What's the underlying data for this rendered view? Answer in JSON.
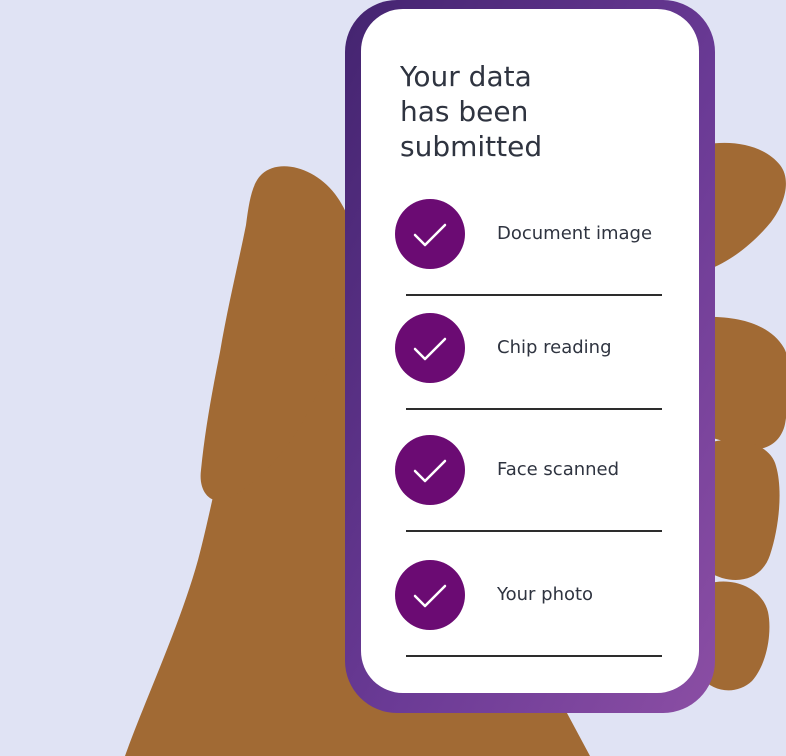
{
  "confirmation": {
    "title": "Your data\nhas been\nsubmitted",
    "items": [
      {
        "label": "Document image",
        "status_icon": "check-icon"
      },
      {
        "label": "Chip reading",
        "status_icon": "check-icon"
      },
      {
        "label": "Face scanned",
        "status_icon": "check-icon"
      },
      {
        "label": "Your photo",
        "status_icon": "check-icon"
      }
    ]
  },
  "colors": {
    "background": "#e0e3f4",
    "skin": "#a16a34",
    "phone_frame_start": "#4a2771",
    "phone_frame_end": "#8545a3",
    "check_circle": "#6b0b73",
    "text": "#2f3440"
  }
}
